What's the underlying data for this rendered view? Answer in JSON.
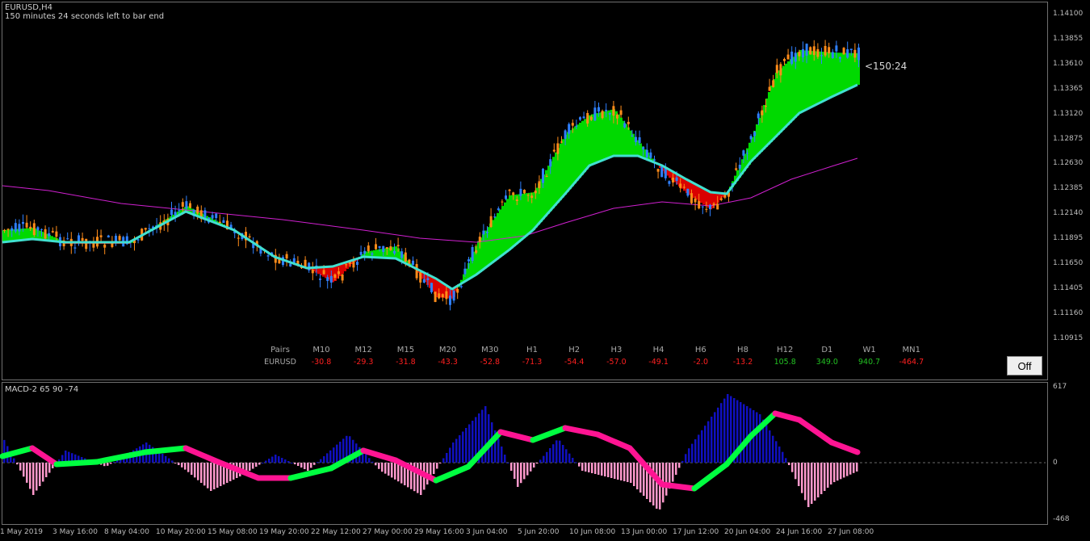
{
  "header": {
    "symbol_title": "EURUSD,H4",
    "countdown_text": "150 minutes 24 seconds left to bar end"
  },
  "timer_label": "<150:24",
  "price_axis": [
    "1.14100",
    "1.13855",
    "1.13610",
    "1.13365",
    "1.13120",
    "1.12875",
    "1.12630",
    "1.12385",
    "1.12140",
    "1.11895",
    "1.11650",
    "1.11405",
    "1.11160",
    "1.10915"
  ],
  "macd": {
    "title": "MACD-2 65 90 -74",
    "axis_top": "617",
    "axis_zero": "0",
    "axis_bottom": "-468"
  },
  "time_axis": [
    "1 May 2019",
    "3 May 16:00",
    "8 May 04:00",
    "10 May 20:00",
    "15 May 08:00",
    "19 May 20:00",
    "22 May 12:00",
    "27 May 00:00",
    "29 May 16:00",
    "3 Jun 04:00",
    "5 Jun 20:00",
    "10 Jun 08:00",
    "13 Jun 00:00",
    "17 Jun 12:00",
    "20 Jun 04:00",
    "24 Jun 16:00",
    "27 Jun 08:00"
  ],
  "strength_grid": {
    "pairs_header": "Pairs",
    "pair": "EURUSD",
    "columns": [
      {
        "tf": "M10",
        "value": "-30.8"
      },
      {
        "tf": "M12",
        "value": "-29.3"
      },
      {
        "tf": "M15",
        "value": "-31.8"
      },
      {
        "tf": "M20",
        "value": "-43.3"
      },
      {
        "tf": "M30",
        "value": "-52.8"
      },
      {
        "tf": "H1",
        "value": "-71.3"
      },
      {
        "tf": "H2",
        "value": "-54.4"
      },
      {
        "tf": "H3",
        "value": "-57.0"
      },
      {
        "tf": "H4",
        "value": "-49.1"
      },
      {
        "tf": "H6",
        "value": "-2.0"
      },
      {
        "tf": "H8",
        "value": "-13.2"
      },
      {
        "tf": "H12",
        "value": "105.8"
      },
      {
        "tf": "D1",
        "value": "349.0"
      },
      {
        "tf": "W1",
        "value": "940.7"
      },
      {
        "tf": "MN1",
        "value": "-464.7"
      }
    ],
    "negative_color": "#ff2020",
    "positive_color": "#22c022"
  },
  "off_button_label": "Off",
  "colors": {
    "bull_candle": "#2f80ff",
    "bear_candle": "#ff8c1a",
    "ribbon_up": "#00ff00",
    "ribbon_down": "#ff0000",
    "fast_ma": "#40e0d0",
    "slow_ma": "#d020d0",
    "macd_up_hist": "#1010c0",
    "macd_down_hist": "#ff99cc",
    "signal_up": "#00ff40",
    "signal_down": "#ff1493"
  }
}
